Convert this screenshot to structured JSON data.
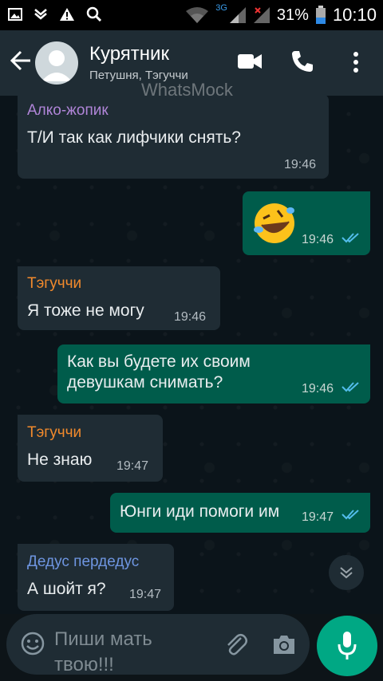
{
  "status_bar": {
    "network_type": "3G",
    "battery_percent": "31%",
    "time": "10:10"
  },
  "header": {
    "title": "Курятник",
    "subtitle": "Петушня, Тэгуччи",
    "watermark": "WhatsMock"
  },
  "messages": [
    {
      "direction": "in",
      "sender": "Алко-жопик",
      "sender_color": "#b085d8",
      "text": "Т/И так как лифчики снять?",
      "time": "19:46"
    },
    {
      "direction": "out",
      "emoji": "rofl-emoji",
      "time": "19:46",
      "read": true
    },
    {
      "direction": "in",
      "sender": "Тэгуччи",
      "sender_color": "#f28a2c",
      "text": "Я тоже не могу",
      "time": "19:46"
    },
    {
      "direction": "out",
      "text_line1": "Как вы будете их своим",
      "text_line2": "девушкам снимать?",
      "time": "19:46",
      "read": true
    },
    {
      "direction": "in",
      "sender": "Тэгуччи",
      "sender_color": "#f28a2c",
      "text": "Не знаю",
      "time": "19:47"
    },
    {
      "direction": "out",
      "text": "Юнги иди помоги им",
      "time": "19:47",
      "read": true
    },
    {
      "direction": "in",
      "sender": "Дедус пердедус",
      "sender_color": "#6e95e0",
      "text": "А шойт я?",
      "time": "19:47"
    }
  ],
  "input": {
    "placeholder_line1": "Пиши мать",
    "placeholder_line2": "твою!!!"
  },
  "colors": {
    "accent": "#00a884",
    "outgoing_bubble": "#005c4b",
    "incoming_bubble": "#1f2c34",
    "read_tick": "#53bdeb"
  }
}
